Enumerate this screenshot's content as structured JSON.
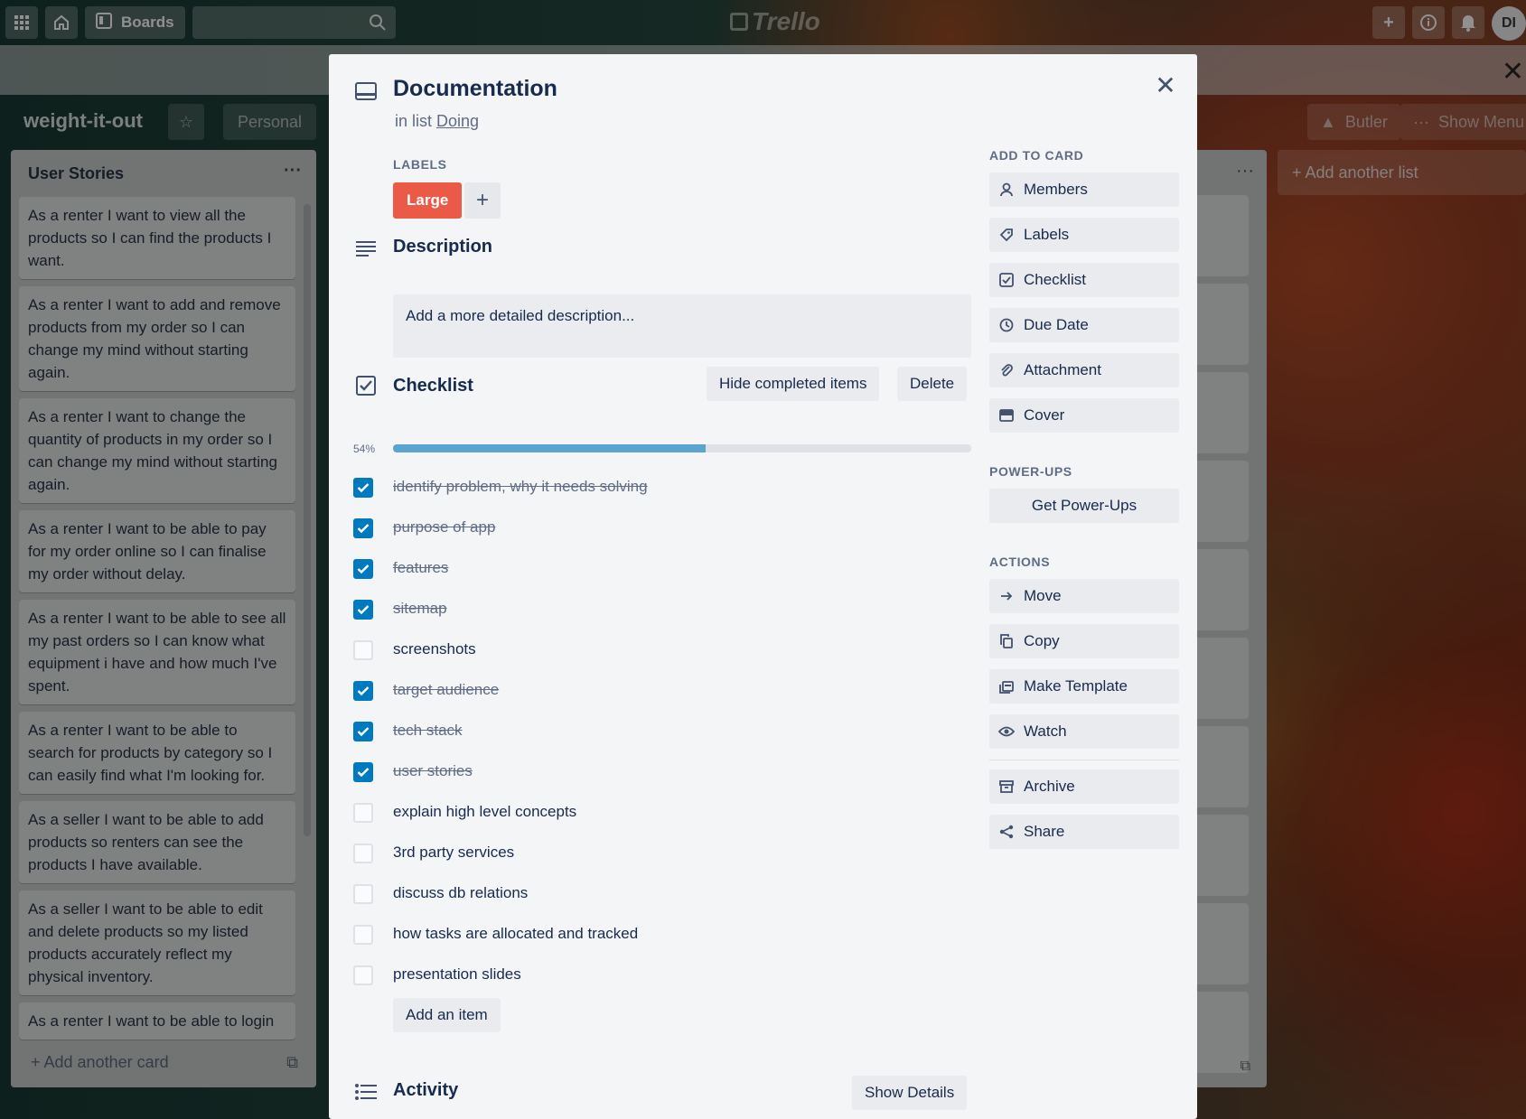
{
  "topbar": {
    "boards_label": "Boards",
    "logo_text": "Trello",
    "avatar_initials": "DI"
  },
  "board": {
    "title": "weight-it-out",
    "personal_label": "Personal",
    "butler_label": "Butler",
    "show_menu_label": "Show Menu",
    "add_list_label": "+ Add another list"
  },
  "left_list": {
    "title": "User Stories",
    "cards": [
      "As a renter I want to view all the products so I can find the products I want.",
      "As a renter I want to add and remove products from my order so I can change my mind without starting again.",
      "As a renter I want to change the quantity of products in my order so I can change my mind without starting again.",
      "As a renter I want to be able to pay for my order online so I can finalise my order without delay.",
      "As a renter I want to be able to see all my past orders so I can know what equipment i have and how much I've spent.",
      "As a renter I want to be able to search for products by category so I can easily find what I'm looking for.",
      "As a seller I want to be able to add products so renters can see the products I have available.",
      "As a seller I want to be able to edit and delete products so my listed products accurately reflect my physical inventory.",
      "As a renter I want to be able to login"
    ],
    "add_card_label": "+ Add another card"
  },
  "modal": {
    "title": "Documentation",
    "in_list_prefix": "in list",
    "list_name": "Doing",
    "labels_heading": "LABELS",
    "label_name": "Large",
    "label_color": "#eb5a46",
    "description_heading": "Description",
    "description_placeholder": "Add a more detailed description...",
    "checklist_heading": "Checklist",
    "hide_completed_label": "Hide completed items",
    "delete_label": "Delete",
    "progress_text": "54%",
    "progress_fraction": 0.54,
    "items": [
      {
        "text": "identify problem, why it needs solving",
        "done": true
      },
      {
        "text": "purpose of app",
        "done": true
      },
      {
        "text": "features",
        "done": true
      },
      {
        "text": "sitemap",
        "done": true
      },
      {
        "text": "screenshots",
        "done": false
      },
      {
        "text": "target audience",
        "done": true
      },
      {
        "text": "tech stack",
        "done": true
      },
      {
        "text": "user stories",
        "done": true
      },
      {
        "text": "explain high level concepts",
        "done": false
      },
      {
        "text": "3rd party services",
        "done": false
      },
      {
        "text": "discuss db relations",
        "done": false
      },
      {
        "text": "how tasks are allocated and tracked",
        "done": false
      },
      {
        "text": "presentation slides",
        "done": false
      }
    ],
    "add_item_label": "Add an item",
    "activity_heading": "Activity",
    "show_details_label": "Show Details",
    "sidebar": {
      "add_to_card_heading": "ADD TO CARD",
      "add_to_card": [
        {
          "label": "Members",
          "icon": "person-icon"
        },
        {
          "label": "Labels",
          "icon": "tag-icon"
        },
        {
          "label": "Checklist",
          "icon": "checkbox-icon"
        },
        {
          "label": "Due Date",
          "icon": "clock-icon"
        },
        {
          "label": "Attachment",
          "icon": "paperclip-icon"
        },
        {
          "label": "Cover",
          "icon": "cover-icon"
        }
      ],
      "powerups_heading": "POWER-UPS",
      "get_powerups_label": "Get Power-Ups",
      "actions_heading": "ACTIONS",
      "actions": [
        {
          "label": "Move",
          "icon": "arrow-right-icon"
        },
        {
          "label": "Copy",
          "icon": "copy-icon"
        },
        {
          "label": "Make Template",
          "icon": "template-icon"
        },
        {
          "label": "Watch",
          "icon": "eye-icon"
        }
      ],
      "archive_label": "Archive",
      "share_label": "Share"
    }
  }
}
